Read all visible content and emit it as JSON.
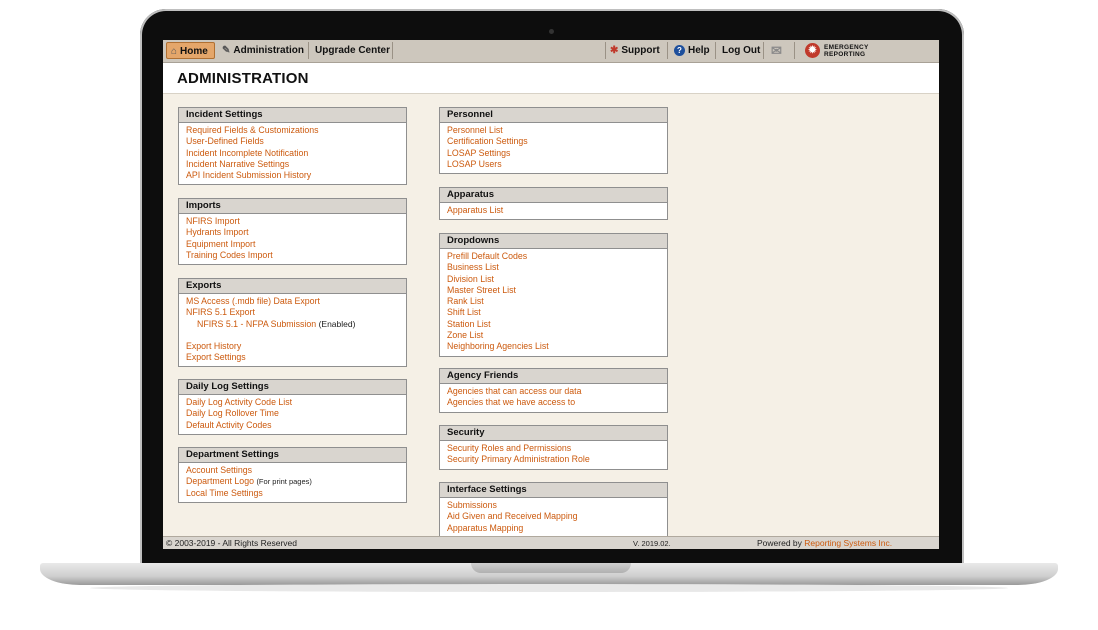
{
  "nav": {
    "home": "Home",
    "administration": "Administration",
    "upgrade_center": "Upgrade Center",
    "support": "Support",
    "help": "Help",
    "logout": "Log Out",
    "logo_line1": "EMERGENCY",
    "logo_line2": "REPORTING"
  },
  "page_title": "ADMINISTRATION",
  "sections": {
    "incident": {
      "title": "Incident Settings",
      "links": [
        "Required Fields & Customizations",
        "User-Defined Fields",
        "Incident Incomplete Notification",
        "Incident Narrative Settings",
        "API Incident Submission History"
      ]
    },
    "imports": {
      "title": "Imports",
      "links": [
        "NFIRS Import",
        "Hydrants Import",
        "Equipment Import",
        "Training Codes Import"
      ]
    },
    "exports": {
      "title": "Exports",
      "links": [
        "MS Access (.mdb file) Data Export",
        "NFIRS 5.1 Export",
        "NFIRS 5.1 - NFPA Submission",
        "Export History",
        "Export Settings"
      ],
      "nfpa_status": "(Enabled)"
    },
    "daily_log": {
      "title": "Daily Log Settings",
      "links": [
        "Daily Log Activity Code List",
        "Daily Log Rollover Time",
        "Default Activity Codes"
      ]
    },
    "department": {
      "title": "Department Settings",
      "links": [
        "Account Settings",
        "Department Logo",
        "Local Time Settings"
      ],
      "logo_note": "(For print pages)"
    },
    "personnel": {
      "title": "Personnel",
      "links": [
        "Personnel List",
        "Certification Settings",
        "LOSAP Settings",
        "LOSAP Users"
      ]
    },
    "apparatus": {
      "title": "Apparatus",
      "links": [
        "Apparatus List"
      ]
    },
    "dropdowns": {
      "title": "Dropdowns",
      "links": [
        "Prefill Default Codes",
        "Business List",
        "Division List",
        "Master Street List",
        "Rank List",
        "Shift List",
        "Station List",
        "Zone List",
        "Neighboring Agencies List"
      ]
    },
    "agency_friends": {
      "title": "Agency Friends",
      "links": [
        "Agencies that can access our data",
        "Agencies that we have access to"
      ]
    },
    "security": {
      "title": "Security",
      "links": [
        "Security Roles and Permissions",
        "Security Primary Administration Role"
      ]
    },
    "interface": {
      "title": "Interface Settings",
      "links": [
        "Submissions",
        "Aid Given and Received Mapping",
        "Apparatus Mapping"
      ]
    }
  },
  "footer": {
    "copyright": "© 2003-2019 - All Rights Reserved",
    "version": "V. 2019.02.",
    "powered_by": "Powered by",
    "company": "Reporting Systems Inc."
  },
  "colors": {
    "link": "#cc5a0e",
    "screen_bg": "#f5f0e6",
    "home_tab": "#e4a66a",
    "section_header": "#d9d5cf"
  },
  "icons": {
    "home": "house-icon",
    "administration": "wrench-icon",
    "support": "lifebuoy-icon",
    "help": "question-circle-icon",
    "mail": "envelope-icon",
    "logo": "emergency-reporting-logo"
  }
}
